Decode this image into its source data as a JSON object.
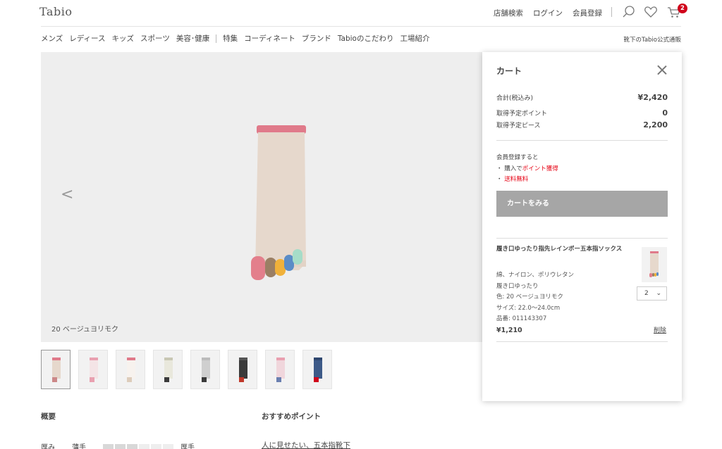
{
  "header": {
    "logo": "Tabio",
    "links": [
      "店舗検索",
      "ログイン",
      "会員登録"
    ],
    "cart_count": "2"
  },
  "nav": {
    "items_left": [
      "メンズ",
      "レディース",
      "キッズ",
      "スポーツ",
      "美容･健康"
    ],
    "items_right": [
      "特集",
      "コーディネート",
      "ブランド",
      "Tabioのこだわり",
      "工場紹介"
    ],
    "corner_text": "靴下のTabio公式通販"
  },
  "hero": {
    "caption": "20 ベージュヨリモク",
    "prev_arrow": "<"
  },
  "thumbnails": [
    {
      "body": "#e6d8cc",
      "top": "#e07a8a",
      "toe": "#c88"
    },
    {
      "body": "#f4e4e6",
      "top": "#e9a0b0",
      "toe": "#e9a0b0"
    },
    {
      "body": "#f7f2ee",
      "top": "#e07a8a",
      "toe": "#dcb"
    },
    {
      "body": "#e9e8dc",
      "top": "#c8c7b4",
      "toe": "#3a3a3a"
    },
    {
      "body": "#cfcfcf",
      "top": "#bcbcbc",
      "toe": "#3a3a3a"
    },
    {
      "body": "#3b3b3b",
      "top": "#555555",
      "toe": "#c0392b"
    },
    {
      "body": "#f0d6dc",
      "top": "#e9a0b0",
      "toe": "#6a7fb0"
    },
    {
      "body": "#3d5a88",
      "top": "#2e466e",
      "toe": "#d0021b"
    }
  ],
  "details": {
    "overview_title": "概要",
    "recommend_title": "おすすめポイント",
    "thickness_label": "厚み",
    "thin_label": "薄手",
    "thick_label": "厚手",
    "thickness_level": 3,
    "thickness_steps": 6,
    "recommend_link": "人に見せたい、五本指靴下"
  },
  "cart": {
    "title": "カート",
    "total_label": "合計(税込み)",
    "total_value": "¥2,420",
    "points_label": "取得予定ポイント",
    "points_value": "0",
    "pieces_label": "取得予定ピース",
    "pieces_value": "2,200",
    "benefit_title": "会員登録すると",
    "benefit_1_prefix": "・ 購入で",
    "benefit_1_red": "ポイント獲得",
    "benefit_2_prefix": "・ ",
    "benefit_2_red": "送料無料",
    "button_label": "カートをみる",
    "item": {
      "name": "履き口ゆったり指先レインボー五本指ソックス",
      "material": "綿、ナイロン、ポリウレタン",
      "feature": "履き口ゆったり",
      "color": "色: 20 ベージュヨリモク",
      "size": "サイズ: 22.0〜24.0cm",
      "code": "品番: 011143307",
      "qty": "2",
      "price": "¥1,210",
      "delete_label": "削除"
    }
  },
  "colors": {
    "accent_red": "#e60012",
    "badge_red": "#d0021b",
    "button_gray": "#a6a6a6",
    "sock_body": "#e6d8cc",
    "sock_cuff": "#e07a8a"
  }
}
